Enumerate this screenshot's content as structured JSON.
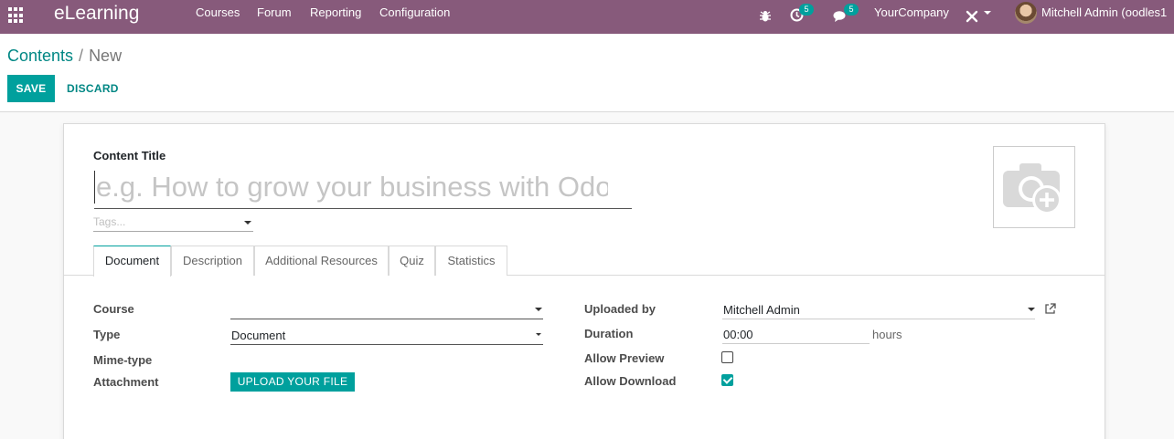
{
  "navbar": {
    "app_name": "eLearning",
    "menus": [
      "Courses",
      "Forum",
      "Reporting",
      "Configuration"
    ],
    "activity_count": "5",
    "messages_count": "5",
    "company": "YourCompany",
    "user": "Mitchell Admin (oodles1"
  },
  "breadcrumb": {
    "parent": "Contents",
    "separator": "/",
    "current": "New"
  },
  "buttons": {
    "save": "SAVE",
    "discard": "DISCARD",
    "upload": "UPLOAD YOUR FILE"
  },
  "form": {
    "title_label": "Content Title",
    "title_placeholder": "e.g. How to grow your business with Odoo",
    "tags_placeholder": "Tags...",
    "tabs": [
      "Document",
      "Description",
      "Additional Resources",
      "Quiz",
      "Statistics"
    ],
    "active_tab": "Document",
    "left": {
      "course_label": "Course",
      "course_value": "",
      "type_label": "Type",
      "type_value": "Document",
      "mime_label": "Mime-type",
      "attachment_label": "Attachment"
    },
    "right": {
      "uploaded_by_label": "Uploaded by",
      "uploaded_by_value": "Mitchell Admin",
      "duration_label": "Duration",
      "duration_value": "00:00",
      "duration_unit": "hours",
      "allow_preview_label": "Allow Preview",
      "allow_preview_checked": false,
      "allow_download_label": "Allow Download",
      "allow_download_checked": true
    }
  },
  "colors": {
    "navbar": "#875A7B",
    "primary": "#00A09D",
    "link": "#008784"
  },
  "icons": [
    "apps-grid-icon",
    "bug-icon",
    "activity-clock-icon",
    "chat-icon",
    "tools-icon",
    "caret-down-icon",
    "camera-plus-icon",
    "external-link-icon"
  ]
}
